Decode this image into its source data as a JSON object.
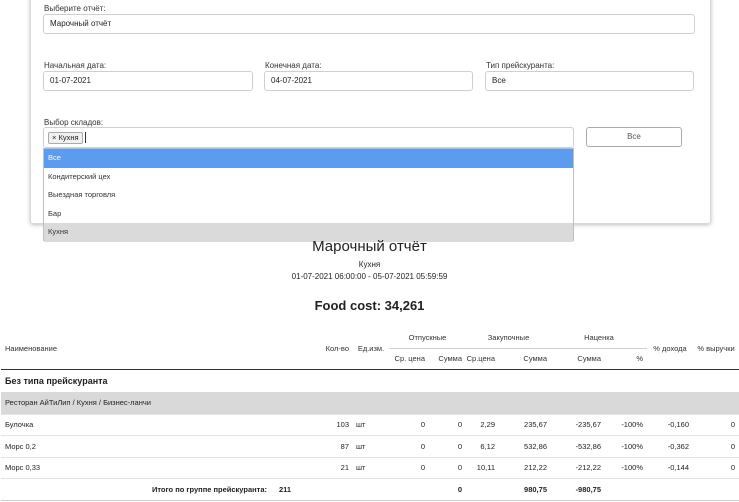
{
  "form": {
    "report_label": "Выберите отчёт:",
    "report_value": "Марочный отчёт",
    "start_label": "Начальная дата:",
    "start_value": "01-07-2021",
    "end_label": "Конечная дата:",
    "end_value": "04-07-2021",
    "price_type_label": "Тип прейскуранта:",
    "price_type_value": "Все",
    "warehouses_label": "Выбор складов:",
    "selected_chip": "× Кухня",
    "all_button": "Все",
    "options": [
      "Все",
      "Кондитерский цех",
      "Выездная торговля",
      "Бар",
      "Кухня"
    ]
  },
  "report": {
    "title": "Марочный отчёт",
    "warehouse": "Кухня",
    "period": "01-07-2021 06:00:00 - 05-07-2021 05:59:59",
    "food_cost": "Food cost: 34,261"
  },
  "table": {
    "headers": {
      "name": "Наименование",
      "qty": "Кол-во",
      "unit": "Ед.изм.",
      "selling": "Отпускные",
      "purchase": "Закупочные",
      "markup": "Наценка",
      "income_pct": "% дохода",
      "revenue_pct": "% выручки",
      "avg_price": "Ср. цена",
      "sum": "Сумма",
      "avg_price2": "Ср.цена",
      "sum2": "Сумма",
      "sum3": "Сумма",
      "pct": "%"
    },
    "group": "Без типа прейскуранта",
    "subgroup": "Ресторан АйТиЛип / Кухня / Бизнес-ланчи",
    "rows": [
      [
        "Булочка",
        "103",
        "шт",
        "0",
        "0",
        "2,29",
        "235,67",
        "-235,67",
        "-100%",
        "-0,160",
        "0"
      ],
      [
        "Морс 0,2",
        "87",
        "шт",
        "0",
        "0",
        "6,12",
        "532,86",
        "-532,86",
        "-100%",
        "-0,362",
        "0"
      ],
      [
        "Морс 0,33",
        "21",
        "шт",
        "0",
        "0",
        "10,11",
        "212,22",
        "-212,22",
        "-100%",
        "-0,144",
        "0"
      ]
    ],
    "total": {
      "label": "Итого по группе прейскуранта:",
      "qty": "211",
      "sum": "0",
      "purchase_sum": "980,75",
      "markup_sum": "-980,75"
    }
  }
}
